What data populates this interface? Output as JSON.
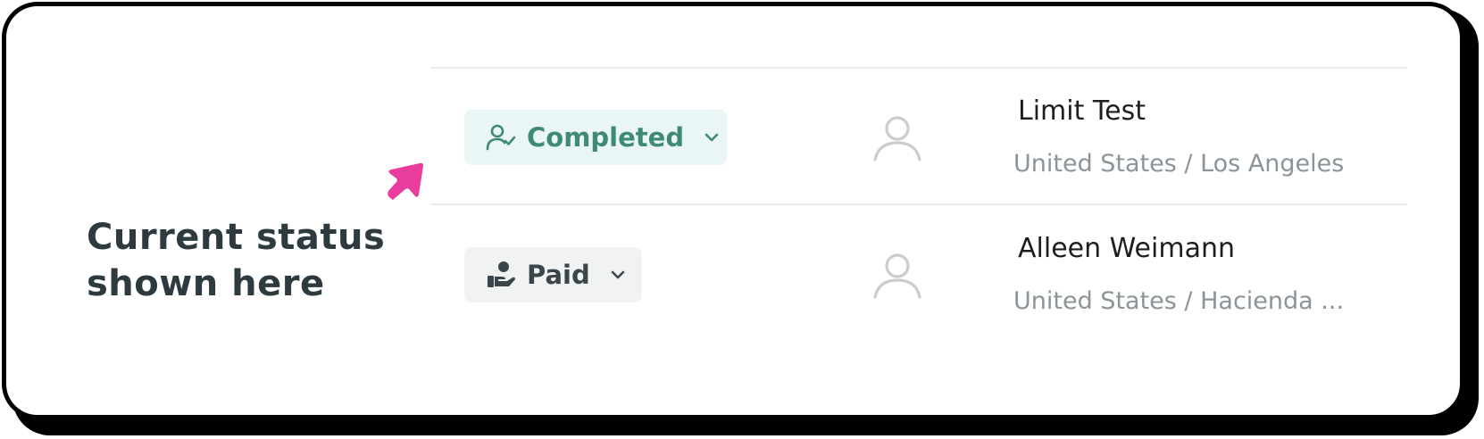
{
  "annotation": {
    "caption_line1": "Current status",
    "caption_line2": "shown here",
    "arrow_color": "#ea3c9c"
  },
  "rows": [
    {
      "status": {
        "label": "Completed",
        "icon": "user-check-icon",
        "text_color": "#3f8a76",
        "background": "#e9f6f5"
      },
      "avatar_icon": "user-icon",
      "name": "Limit Test",
      "location": "United States / Los Angeles"
    },
    {
      "status": {
        "label": "Paid",
        "icon": "hand-money-icon",
        "text_color": "#3a464c",
        "background": "#f1f3f3"
      },
      "avatar_icon": "user-icon",
      "name": "Alleen Weimann",
      "location": "United States / Hacienda ..."
    }
  ]
}
